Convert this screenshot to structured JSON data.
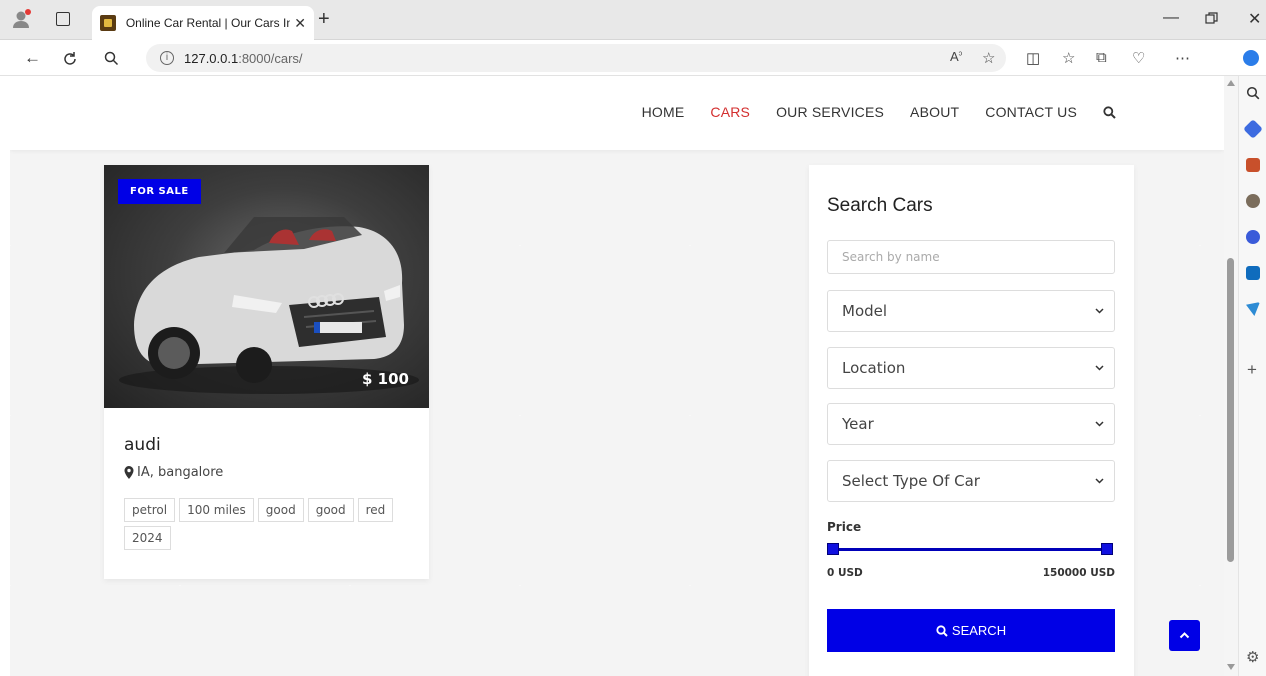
{
  "browser": {
    "tab_title": "Online Car Rental | Our Cars Inve",
    "url_host": "127.0.0.1",
    "url_path": ":8000/cars/"
  },
  "site": {
    "nav": {
      "home": "HOME",
      "cars": "CARS",
      "services": "OUR SERVICES",
      "about": "ABOUT",
      "contact": "CONTACT US"
    },
    "accent_color": "#0000e6",
    "active_nav_color": "#d32f2f"
  },
  "car": {
    "badge": "FOR SALE",
    "price": "$ 100",
    "name": "audi",
    "location": "IA, bangalore",
    "tags": [
      "petrol",
      "100 miles",
      "good",
      "good",
      "red",
      "2024"
    ]
  },
  "search": {
    "title": "Search Cars",
    "name_placeholder": "Search by name",
    "model": "Model",
    "location": "Location",
    "year": "Year",
    "type": "Select Type Of Car",
    "price_label": "Price",
    "min": "0 USD",
    "max": "150000 USD",
    "button": "SEARCH"
  }
}
